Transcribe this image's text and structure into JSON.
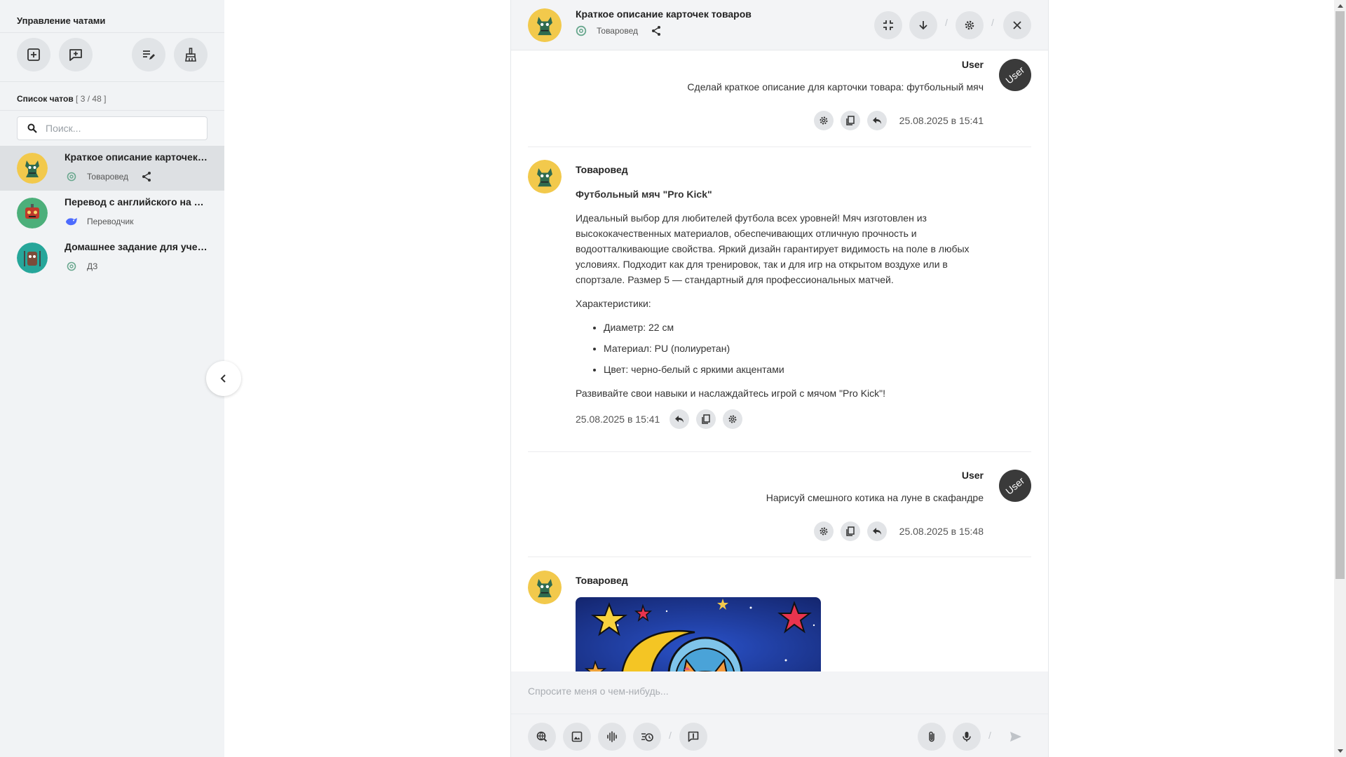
{
  "sidebar": {
    "title": "Управление чатами",
    "actions": [
      {
        "icon": "new-chat-icon"
      },
      {
        "icon": "new-comment-icon"
      },
      {
        "icon": "edit-list-icon"
      },
      {
        "icon": "clean-icon"
      }
    ],
    "list_label": "Список чатов",
    "list_count": "[ 3 / 48 ]",
    "search_placeholder": "Поиск...",
    "chats": [
      {
        "title": "Краткое описание карточек товаров",
        "model_icon": "openai-icon",
        "assistant": "Товаровед",
        "shared": true,
        "active": true
      },
      {
        "title": "Перевод с английского на русский",
        "model_icon": "deepseek-icon",
        "assistant": "Переводчик",
        "shared": false,
        "active": false
      },
      {
        "title": "Домашнее задание для ученика",
        "model_icon": "openai-icon",
        "assistant": "ДЗ",
        "shared": false,
        "active": false
      }
    ]
  },
  "header": {
    "title": "Краткое описание карточек товаров",
    "assistant": "Товаровед"
  },
  "messages": [
    {
      "role": "user",
      "name": "User",
      "avatar_text": "User",
      "text": "Сделай краткое описание для карточки товара: футбольный мяч",
      "time": "25.08.2025 в 15:41"
    },
    {
      "role": "assistant",
      "name": "Товаровед",
      "heading": "Футбольный мяч \"Pro Kick\"",
      "paragraph": "Идеальный выбор для любителей футбола всех уровней! Мяч изготовлен из высококачественных материалов, обеспечивающих отличную прочность и водоотталкивающие свойства. Яркий дизайн гарантирует видимость на поле в любых условиях. Подходит как для тренировок, так и для игр на открытом воздухе или в спортзале. Размер 5 — стандартный для профессиональных матчей.",
      "list_title": "Характеристики:",
      "list": [
        "Диаметр: 22 см",
        "Материал: PU (полиуретан)",
        "Цвет: черно-белый с яркими акцентами"
      ],
      "closing": "Развивайте свои навыки и наслаждайтесь игрой с мячом \"Pro Kick\"!",
      "time": "25.08.2025 в 15:41"
    },
    {
      "role": "user",
      "name": "User",
      "avatar_text": "User",
      "text": "Нарисуй смешного котика на луне в скафандре",
      "time": "25.08.2025 в 15:48"
    },
    {
      "role": "assistant",
      "name": "Товаровед",
      "image": "generated-cat-on-moon-image"
    }
  ],
  "input": {
    "placeholder": "Спросите меня о чем-нибудь..."
  },
  "colors": {
    "sidebar_bg": "#f1f3f5",
    "active_chat_bg": "#dde0e3",
    "button_bg": "#e2e4e7",
    "panel_header_bg": "#f3f4f6",
    "user_avatar_bg": "#3a3a3a",
    "assistant_avatar_bg": "#f2c94c"
  }
}
